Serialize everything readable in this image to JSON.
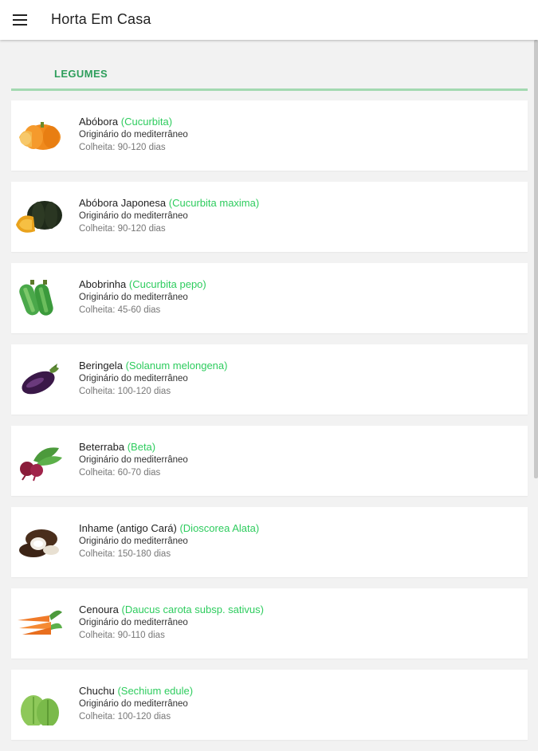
{
  "app": {
    "title": "Horta Em Casa"
  },
  "section": {
    "title": "LEGUMES"
  },
  "items": [
    {
      "name": "Abóbora",
      "scientific": "(Cucurbita)",
      "origin": "Originário do mediterrâneo",
      "harvest": "Colheita: 90-120 dias",
      "icon": "pumpkin-icon"
    },
    {
      "name": "Abóbora Japonesa",
      "scientific": "(Cucurbita maxima)",
      "origin": "Originário do mediterrâneo",
      "harvest": "Colheita: 90-120 dias",
      "icon": "japanese-pumpkin-icon"
    },
    {
      "name": "Abobrinha",
      "scientific": "(Cucurbita pepo)",
      "origin": "Originário do mediterrâneo",
      "harvest": "Colheita: 45-60 dias",
      "icon": "zucchini-icon"
    },
    {
      "name": "Beringela",
      "scientific": "(Solanum melongena)",
      "origin": "Originário do mediterrâneo",
      "harvest": "Colheita: 100-120 dias",
      "icon": "eggplant-icon"
    },
    {
      "name": "Beterraba",
      "scientific": "(Beta)",
      "origin": "Originário do mediterrâneo",
      "harvest": "Colheita: 60-70 dias",
      "icon": "beet-icon"
    },
    {
      "name": "Inhame (antigo Cará)",
      "scientific": "(Dioscorea Alata)",
      "origin": "Originário do mediterrâneo",
      "harvest": "Colheita: 150-180 dias",
      "icon": "yam-icon"
    },
    {
      "name": "Cenoura",
      "scientific": "(Daucus carota subsp. sativus)",
      "origin": "Originário do mediterrâneo",
      "harvest": "Colheita: 90-110 dias",
      "icon": "carrot-icon"
    },
    {
      "name": "Chuchu",
      "scientific": "(Sechium edule)",
      "origin": "Originário do mediterrâneo",
      "harvest": "Colheita: 100-120 dias",
      "icon": "chayote-icon"
    }
  ],
  "colors": {
    "accent": "#2ecc5e",
    "section_title": "#2e9e5b",
    "divider": "#a3d9b1",
    "background": "#f2f2f2"
  }
}
